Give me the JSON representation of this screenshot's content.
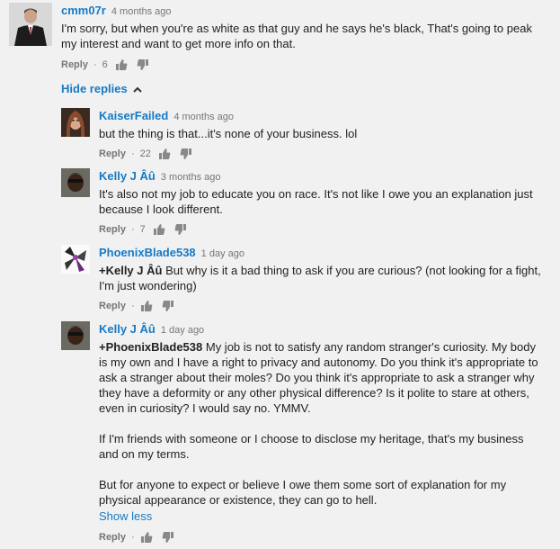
{
  "top_comment": {
    "author": "cmm07r",
    "time": "4 months ago",
    "text": "I'm sorry, but when you're as white as that guy and he says he's black, That's going to peak my interest and want to get more info on that.",
    "reply_label": "Reply",
    "likes": "6"
  },
  "hide_replies_label": "Hide replies",
  "replies": [
    {
      "author": "KaiserFailed",
      "time": "4 months ago",
      "text": "but the thing is that...it's none of your business. lol",
      "reply_label": "Reply",
      "likes": "22"
    },
    {
      "author": "Kelly J Âû",
      "time": "3 months ago",
      "text": "It's also not my job to educate you on race. It's not like I owe you an explanation just because I look different.",
      "reply_label": "Reply",
      "likes": "7"
    },
    {
      "author": "PhoenixBlade538",
      "time": "1 day ago",
      "mention": "+Kelly J Âû",
      "text": " But why is it a bad thing to ask if you are curious? (not looking for a fight, I'm just wondering)",
      "reply_label": "Reply",
      "likes": ""
    },
    {
      "author": "Kelly J Âû",
      "time": "1 day ago",
      "mention": "+PhoenixBlade538",
      "text": " My job is not to satisfy any random stranger's curiosity. My body is my own and I have a right to privacy and autonomy. Do you think it's appropriate to ask a stranger about their moles? Do you think it's appropriate to ask a stranger why they have a deformity or any other physical difference? Is it polite to stare at others, even in curiosity? I would say no. YMMV.",
      "paragraph2": "If I'm friends with someone or I choose to disclose my heritage, that's my business and on my terms.",
      "paragraph3": "But for anyone to expect or believe I owe them some sort of explanation for my physical appearance or existence, they can go to hell.",
      "show_less_label": "Show less",
      "reply_label": "Reply",
      "likes": ""
    }
  ],
  "colors": {
    "link": "#167ac6",
    "muted": "#767676",
    "background": "#f1f1f1"
  },
  "icons": {
    "like": "thumbs-up-icon",
    "dislike": "thumbs-down-icon",
    "collapse": "chevron-up-icon"
  }
}
